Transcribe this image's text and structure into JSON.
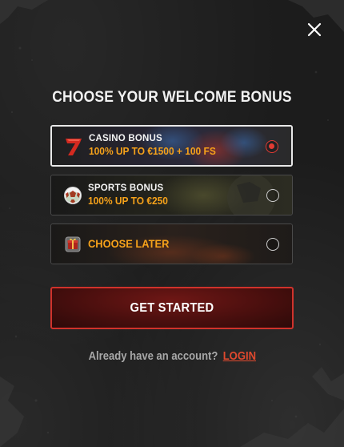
{
  "modal": {
    "title": "CHOOSE YOUR WELCOME BONUS",
    "close_icon": "close-icon"
  },
  "options": [
    {
      "id": "casino",
      "label": "CASINO BONUS",
      "description": "100% UP TO €1500 + 100 FS",
      "icon": "lucky-seven-icon",
      "selected": true
    },
    {
      "id": "sports",
      "label": "SPORTS BONUS",
      "description": "100% UP TO €250",
      "icon": "soccer-ball-icon",
      "selected": false
    },
    {
      "id": "later",
      "label": "",
      "description": "CHOOSE LATER",
      "icon": "gift-box-icon",
      "selected": false
    }
  ],
  "cta": {
    "label": "GET STARTED"
  },
  "footer": {
    "prompt": "Already have an account?",
    "login_label": "LOGIN"
  },
  "colors": {
    "accent": "#f6a21a",
    "primary_red": "#d0322b",
    "login_link": "#e0492e",
    "background": "#1c1c1c"
  }
}
